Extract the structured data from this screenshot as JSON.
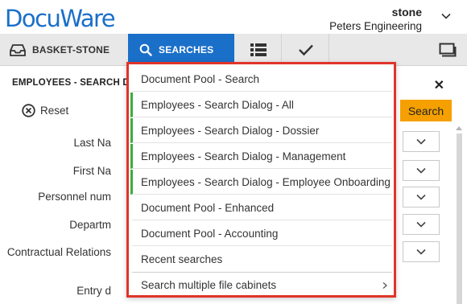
{
  "header": {
    "logo": "DocuWare",
    "user_name": "stone",
    "organization": "Peters Engineering"
  },
  "nav": {
    "basket_label": "BASKET-STONE",
    "searches_label": "SEARCHES"
  },
  "panel": {
    "title": "EMPLOYEES - SEARCH D",
    "reset_label": "Reset",
    "search_button": "Search",
    "fields": [
      "Last Na",
      "First Na",
      "Personnel num",
      "Departm",
      "Contractual Relations",
      "Entry d"
    ]
  },
  "menu": {
    "items": [
      "Document Pool - Search",
      "Employees - Search Dialog - All",
      "Employees - Search Dialog - Dossier",
      "Employees - Search Dialog - Management",
      "Employees - Search Dialog - Employee Onboarding",
      "Document Pool - Enhanced",
      "Document Pool - Accounting",
      "Recent searches"
    ],
    "more_label": "Search multiple file cabinets"
  },
  "colors": {
    "brand": "#1a6fc9",
    "search_button": "#f5a000",
    "highlight_border": "#e0342a",
    "accent_green": "#3cad3c"
  }
}
